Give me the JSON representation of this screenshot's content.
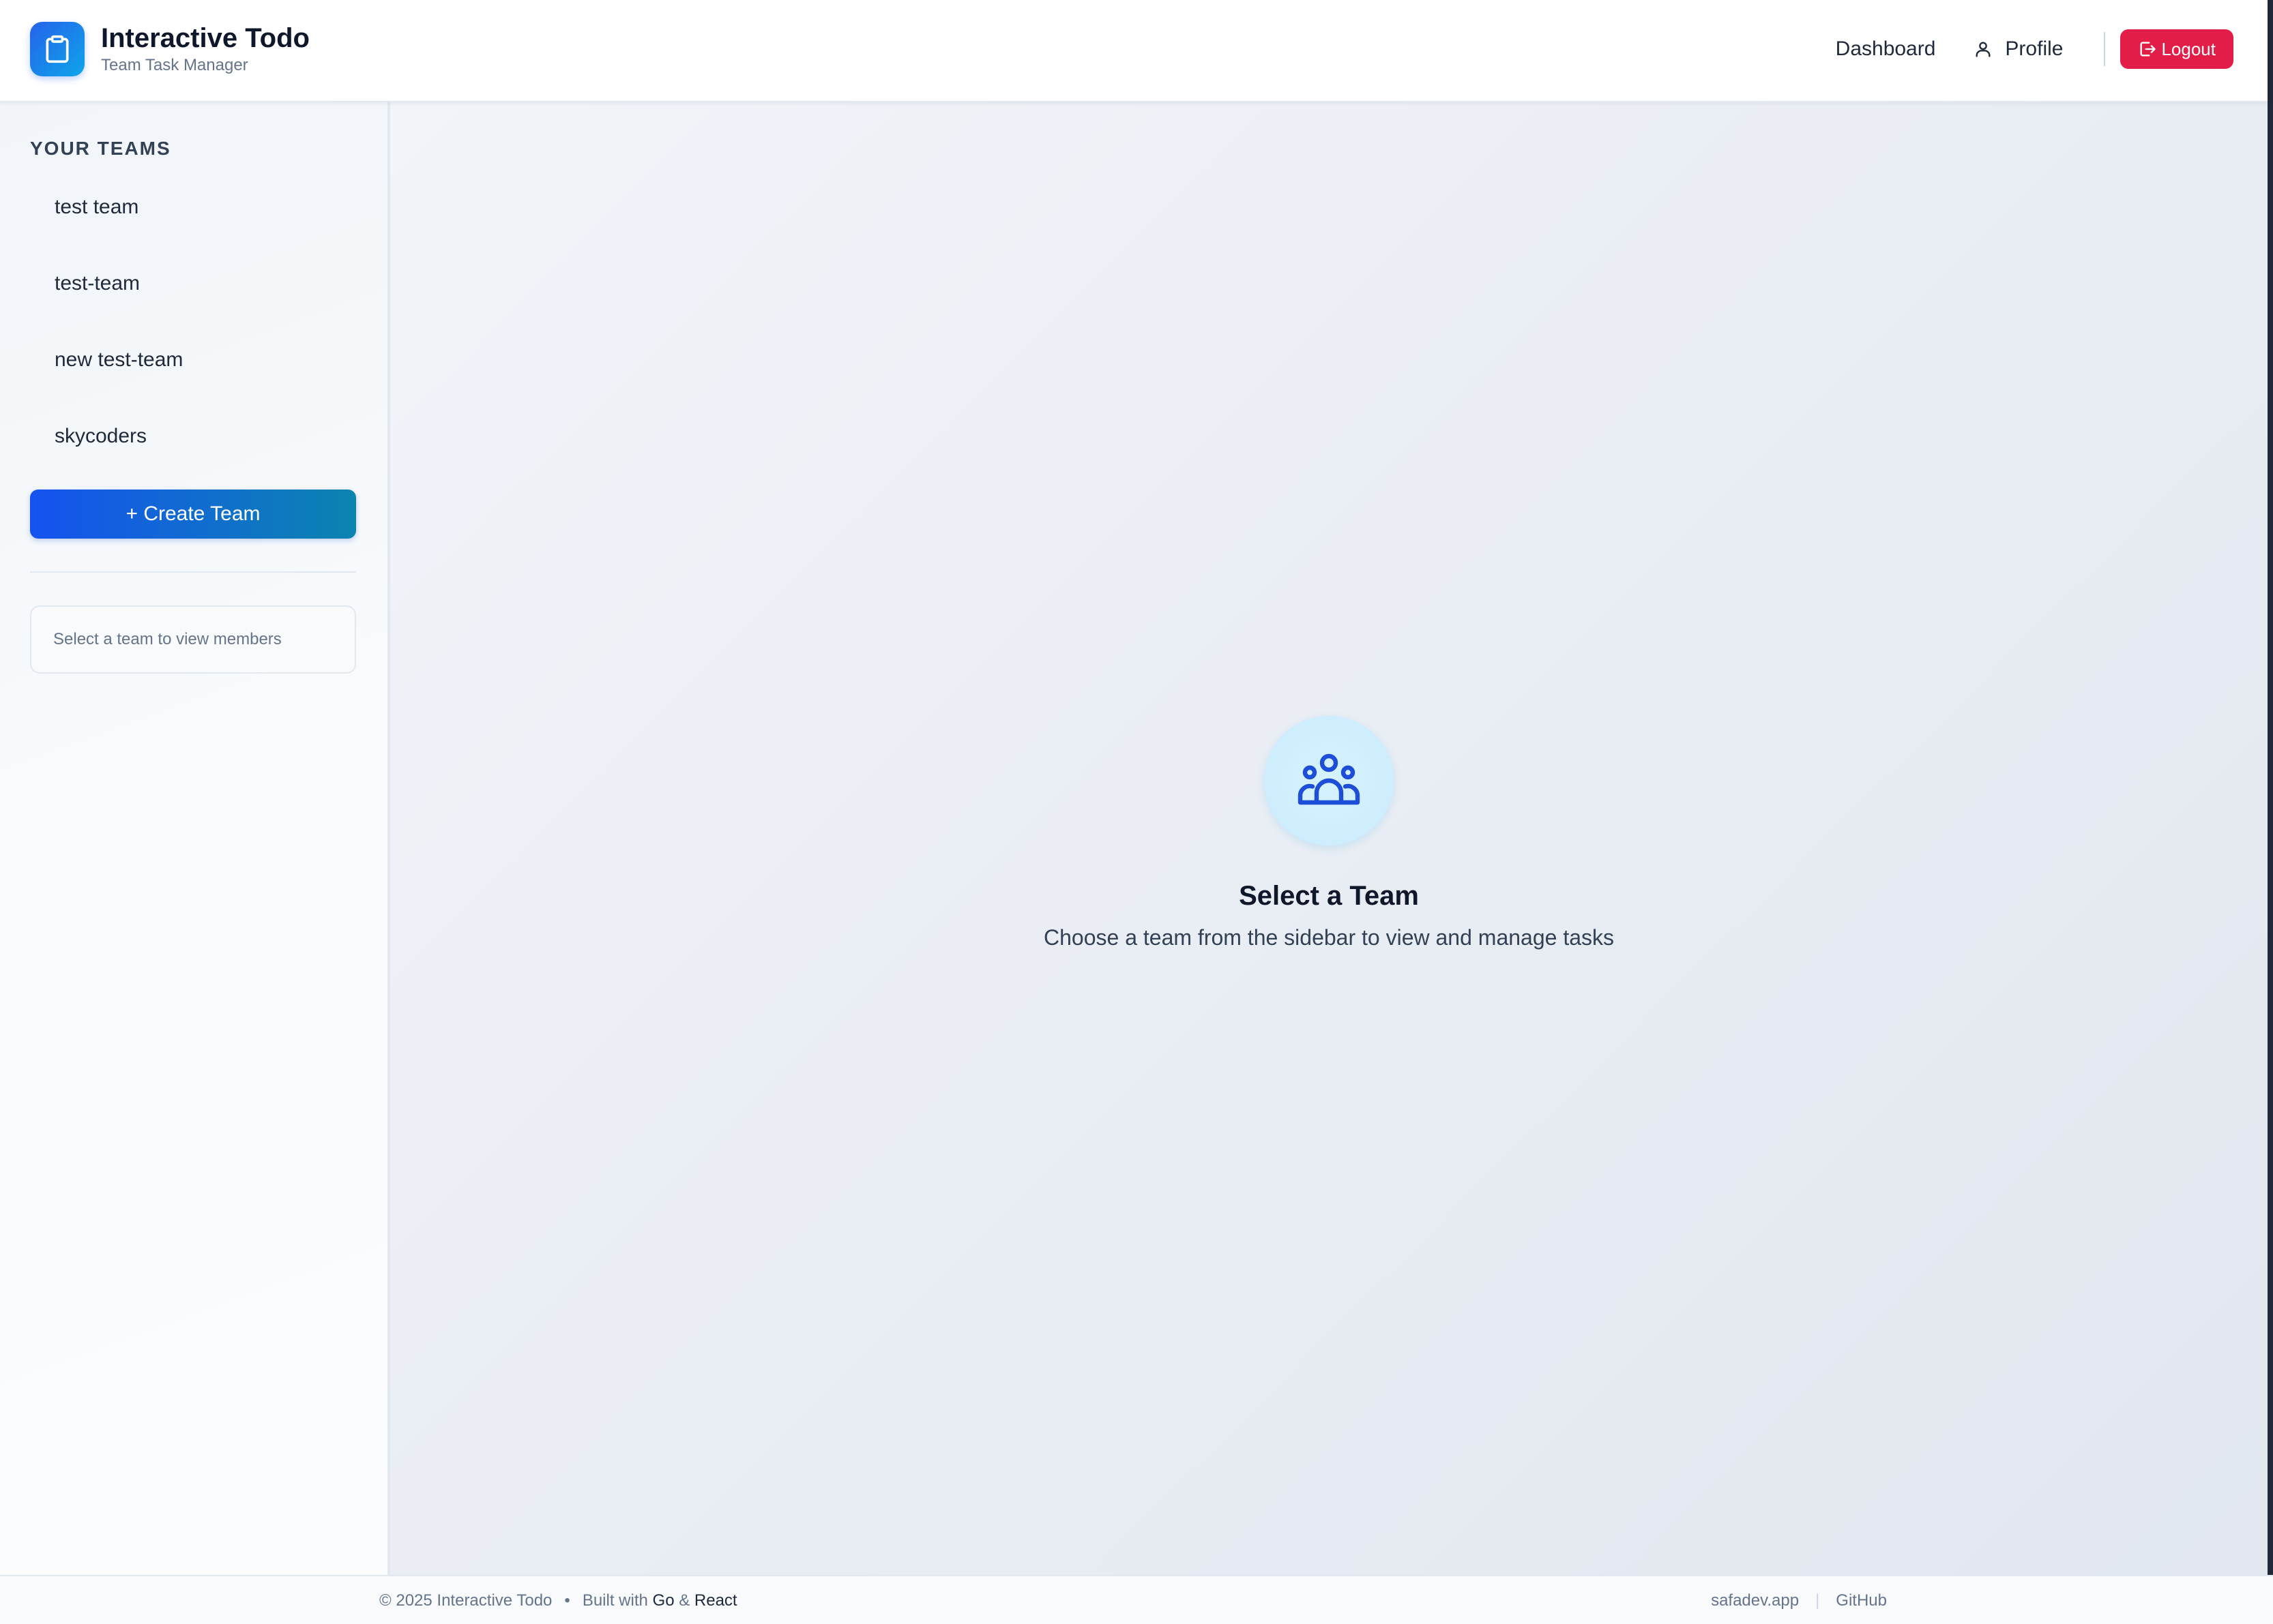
{
  "header": {
    "app_title": "Interactive Todo",
    "app_subtitle": "Team Task Manager",
    "logo_icon": "clipboard-icon",
    "nav": {
      "dashboard": "Dashboard",
      "profile": "Profile",
      "logout": "Logout"
    }
  },
  "sidebar": {
    "heading": "YOUR TEAMS",
    "teams": [
      "test team",
      "test-team",
      "new test-team",
      "skycoders"
    ],
    "create_button": "+ Create Team",
    "members_placeholder": "Select a team to view members"
  },
  "main": {
    "empty_icon": "users-icon",
    "empty_title": "Select a Team",
    "empty_subtitle": "Choose a team from the sidebar to view and manage tasks"
  },
  "footer": {
    "copyright": "© 2025 Interactive Todo",
    "separator": "•",
    "built_with": "Built with",
    "tech1": "Go",
    "amp": "&",
    "tech2": "React",
    "link1": "safadev.app",
    "pipe": "|",
    "link2": "GitHub"
  },
  "colors": {
    "primary": "#2563eb",
    "logout": "#e11d48",
    "accent_cyan": "#0891b2"
  }
}
